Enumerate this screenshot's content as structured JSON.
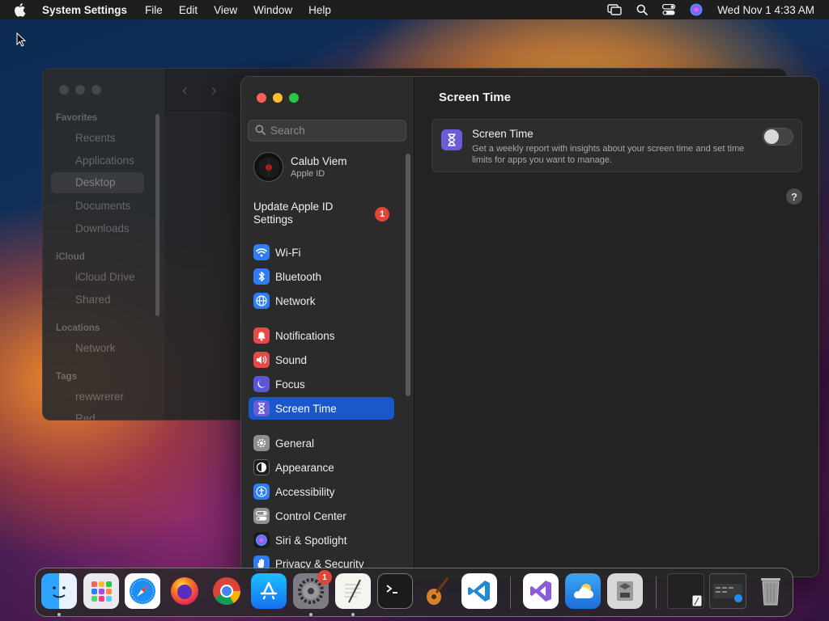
{
  "menubar": {
    "app_name": "System Settings",
    "menus": [
      "File",
      "Edit",
      "View",
      "Window",
      "Help"
    ],
    "clock": "Wed Nov 1  4:33 AM"
  },
  "finder": {
    "favorites_header": "Favorites",
    "favorites": [
      "Recents",
      "Applications",
      "Desktop",
      "Documents",
      "Downloads"
    ],
    "icloud_header": "iCloud",
    "icloud": [
      "iCloud Drive",
      "Shared"
    ],
    "locations_header": "Locations",
    "locations": [
      "Network"
    ],
    "tags_header": "Tags",
    "tags": [
      "rewwrerer",
      "Red"
    ]
  },
  "settings": {
    "search_placeholder": "Search",
    "user": {
      "name": "Calub Viem",
      "subtitle": "Apple ID"
    },
    "update": {
      "label": "Update Apple ID Settings",
      "badge": "1"
    },
    "nav": [
      {
        "label": "Wi-Fi",
        "icon": "wifi-icon",
        "color": "#2f7df6"
      },
      {
        "label": "Bluetooth",
        "icon": "bluetooth-icon",
        "color": "#2f7df6"
      },
      {
        "label": "Network",
        "icon": "globe-icon",
        "color": "#2f7df6"
      },
      {
        "label": "Notifications",
        "icon": "bell-icon",
        "color": "#e8484a"
      },
      {
        "label": "Sound",
        "icon": "speaker-icon",
        "color": "#e8484a"
      },
      {
        "label": "Focus",
        "icon": "moon-icon",
        "color": "#5b56d6"
      },
      {
        "label": "Screen Time",
        "icon": "hourglass-icon",
        "color": "#6b5dd8"
      },
      {
        "label": "General",
        "icon": "gear-icon",
        "color": "#8e8e93"
      },
      {
        "label": "Appearance",
        "icon": "appearance-icon",
        "color": "#1c1c1c"
      },
      {
        "label": "Accessibility",
        "icon": "accessibility-icon",
        "color": "#2f7df6"
      },
      {
        "label": "Control Center",
        "icon": "control-center-icon",
        "color": "#8e8e93"
      },
      {
        "label": "Siri & Spotlight",
        "icon": "siri-icon",
        "color": "#b04ad6"
      },
      {
        "label": "Privacy & Security",
        "icon": "hand-icon",
        "color": "#2f7df6"
      }
    ],
    "active": "Screen Time",
    "page_title": "Screen Time",
    "card": {
      "title": "Screen Time",
      "description": "Get a weekly report with insights about your screen time and set time limits for apps you want to manage.",
      "toggle_on": false
    },
    "help_label": "?"
  },
  "dock": {
    "apps": [
      "Finder",
      "Launchpad",
      "Safari",
      "Firefox",
      "Chrome",
      "App Store",
      "System Settings",
      "TextEdit",
      "Terminal",
      "GarageBand",
      "Visual Studio Code",
      "Visual Studio",
      "Weather",
      "Boot Camp",
      "Window 1",
      "Window 2",
      "Trash"
    ],
    "settings_badge": "1"
  },
  "colors": {
    "accent": "#1958c8",
    "badge": "#e0453a",
    "traffic_close": "#ff5f57",
    "traffic_min": "#febc2e",
    "traffic_max": "#28c840"
  }
}
